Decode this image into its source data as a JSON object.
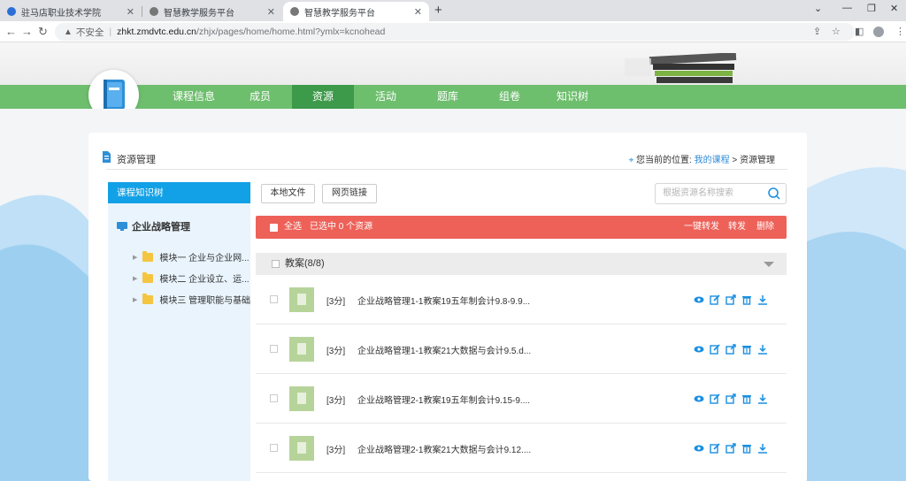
{
  "browser": {
    "tabs": [
      {
        "title": "驻马店职业技术学院"
      },
      {
        "title": "智慧教学服务平台"
      },
      {
        "title": "智慧教学服务平台"
      }
    ],
    "address": {
      "security_label": "不安全",
      "host": "zhkt.zmdvtc.edu.cn",
      "path": "/zhjx/pages/home/home.html?ymlx=kcnohead"
    }
  },
  "nav": {
    "items": [
      "课程信息",
      "成员",
      "资源",
      "活动",
      "题库",
      "组卷",
      "知识树"
    ],
    "active_index": 2,
    "bar_color": "#6dbe6d",
    "active_color": "#3d9a4a"
  },
  "header": {
    "title": "资源管理",
    "location_prefix": "您当前的位置:",
    "location_link": "我的课程",
    "location_sep": ">",
    "location_current": "资源管理"
  },
  "sidebar": {
    "header": "课程知识树",
    "root": "企业战略管理",
    "items": [
      "模块一 企业与企业网...",
      "模块二 企业设立、运...",
      "模块三 管理职能与基础"
    ]
  },
  "toolbar": {
    "local_file": "本地文件",
    "web_link": "网页链接",
    "search_placeholder": "根据资源名称搜索"
  },
  "selection_bar": {
    "select_all": "全选",
    "selected_text": "已选中 0 个资源",
    "one_click_forward": "一键转发",
    "forward": "转发",
    "delete": "删除",
    "color": "#ed6158"
  },
  "group": {
    "label": "教案(8/8)"
  },
  "files": [
    {
      "score": "[3分]",
      "name": "企业战略管理1-1教案19五年制会计9.8-9.9..."
    },
    {
      "score": "[3分]",
      "name": "企业战略管理1-1教案21大数据与会计9.5.d..."
    },
    {
      "score": "[3分]",
      "name": "企业战略管理2-1教案19五年制会计9.15-9...."
    },
    {
      "score": "[3分]",
      "name": "企业战略管理2-1教案21大数据与会计9.12...."
    }
  ],
  "icons": {
    "action_color": "#1a8fe0"
  }
}
